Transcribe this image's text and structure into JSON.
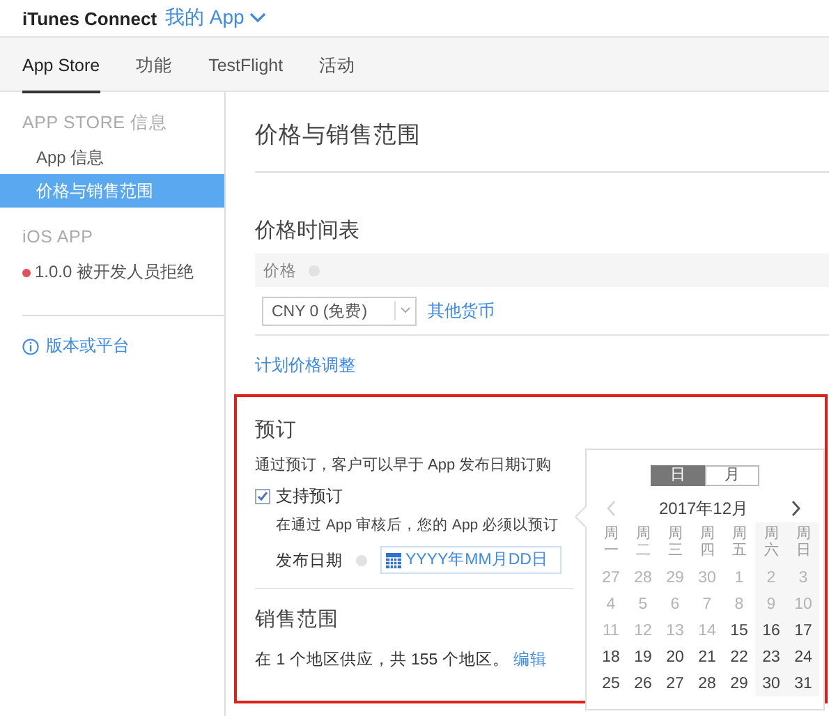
{
  "header": {
    "brand": "iTunes Connect",
    "app_menu": "我的 App"
  },
  "tabs": [
    {
      "label": "App Store",
      "selected": true
    },
    {
      "label": "功能",
      "selected": false
    },
    {
      "label": "TestFlight",
      "selected": false
    },
    {
      "label": "活动",
      "selected": false
    }
  ],
  "sidebar": {
    "groups": [
      {
        "heading": "APP STORE 信息",
        "items": [
          {
            "label": "App 信息",
            "selected": false
          },
          {
            "label": "价格与销售范围",
            "selected": true
          }
        ]
      },
      {
        "heading": "iOS APP",
        "versions": [
          {
            "label": "1.0.0 被开发人员拒绝",
            "color": "#e0525a"
          }
        ]
      }
    ],
    "add_link": "版本或平台"
  },
  "main": {
    "title": "价格与销售范围",
    "price_schedule": {
      "heading": "价格时间表",
      "column": "价格",
      "price": "CNY 0 (免费)",
      "other_currency": "其他货币",
      "plan_link": "计划价格调整"
    },
    "preorder": {
      "heading": "预订",
      "description": "通过预订，客户可以早于 App 发布日期订购",
      "checkbox": {
        "label": "支持预订",
        "checked": true
      },
      "note": "在通过 App 审核后，您的 App 必须以预订",
      "date_label": "发布日期",
      "date_placeholder": "YYYY年MM月DD日"
    },
    "availability": {
      "heading": "销售范围",
      "text": "在 1 个地区供应，共 155 个地区。",
      "edit_link": "编辑"
    }
  },
  "datepicker": {
    "modes": [
      {
        "label": "日",
        "selected": true
      },
      {
        "label": "月",
        "selected": false
      }
    ],
    "month": "2017年12月",
    "prev_disabled": true,
    "weekdays": [
      "周一",
      "周二",
      "周三",
      "周四",
      "周五",
      "周六",
      "周日"
    ],
    "weeks": [
      [
        {
          "day": "27",
          "disabled": true
        },
        {
          "day": "28",
          "disabled": true
        },
        {
          "day": "29",
          "disabled": true
        },
        {
          "day": "30",
          "disabled": true
        },
        {
          "day": "1",
          "disabled": true
        },
        {
          "day": "2",
          "disabled": true
        },
        {
          "day": "3",
          "disabled": true
        }
      ],
      [
        {
          "day": "4",
          "disabled": true
        },
        {
          "day": "5",
          "disabled": true
        },
        {
          "day": "6",
          "disabled": true
        },
        {
          "day": "7",
          "disabled": true
        },
        {
          "day": "8",
          "disabled": true
        },
        {
          "day": "9",
          "disabled": true
        },
        {
          "day": "10",
          "disabled": true
        }
      ],
      [
        {
          "day": "11",
          "disabled": true
        },
        {
          "day": "12",
          "disabled": true
        },
        {
          "day": "13",
          "disabled": true
        },
        {
          "day": "14",
          "disabled": true
        },
        {
          "day": "15",
          "disabled": false
        },
        {
          "day": "16",
          "disabled": false
        },
        {
          "day": "17",
          "disabled": false
        }
      ],
      [
        {
          "day": "18",
          "disabled": false
        },
        {
          "day": "19",
          "disabled": false
        },
        {
          "day": "20",
          "disabled": false
        },
        {
          "day": "21",
          "disabled": false
        },
        {
          "day": "22",
          "disabled": false
        },
        {
          "day": "23",
          "disabled": false
        },
        {
          "day": "24",
          "disabled": false
        }
      ],
      [
        {
          "day": "25",
          "disabled": false
        },
        {
          "day": "26",
          "disabled": false
        },
        {
          "day": "27",
          "disabled": false
        },
        {
          "day": "28",
          "disabled": false
        },
        {
          "day": "29",
          "disabled": false
        },
        {
          "day": "30",
          "disabled": false
        },
        {
          "day": "31",
          "disabled": false
        }
      ]
    ]
  }
}
